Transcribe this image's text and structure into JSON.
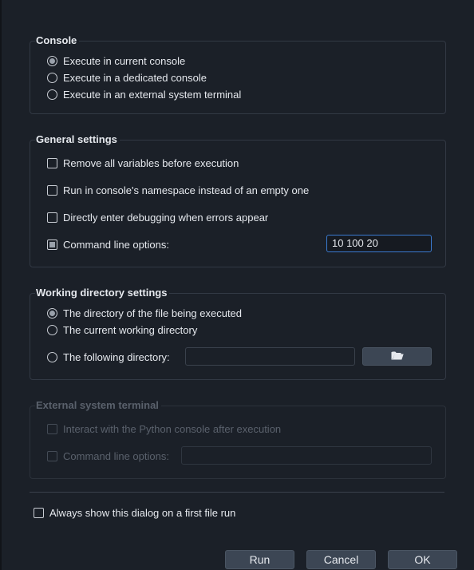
{
  "console": {
    "title": "Console",
    "options": [
      {
        "label": "Execute in current console",
        "checked": true
      },
      {
        "label": "Execute in a dedicated console",
        "checked": false
      },
      {
        "label": "Execute in an external system terminal",
        "checked": false
      }
    ]
  },
  "general": {
    "title": "General settings",
    "remove_vars": "Remove all variables before execution",
    "run_namespace": "Run in console's namespace instead of an empty one",
    "debug_errors": "Directly enter debugging when errors appear",
    "cmd_options_label": "Command line options:",
    "cmd_options_value": "10 100 20"
  },
  "workdir": {
    "title": "Working directory settings",
    "file_dir": "The directory of the file being executed",
    "current_dir": "The current working directory",
    "following_dir": "The following directory:",
    "following_dir_value": "",
    "folder_icon": "folder-open-icon"
  },
  "external": {
    "title": "External system terminal",
    "interact": "Interact with the Python console after execution",
    "cmd_options_label": "Command line options:",
    "cmd_options_value": ""
  },
  "always_show": "Always show this dialog on a first file run",
  "buttons": {
    "run": "Run",
    "cancel": "Cancel",
    "ok": "OK"
  },
  "colors": {
    "background": "#1b2028",
    "focus_border": "#3a7ad0",
    "button": "#3c4654"
  }
}
